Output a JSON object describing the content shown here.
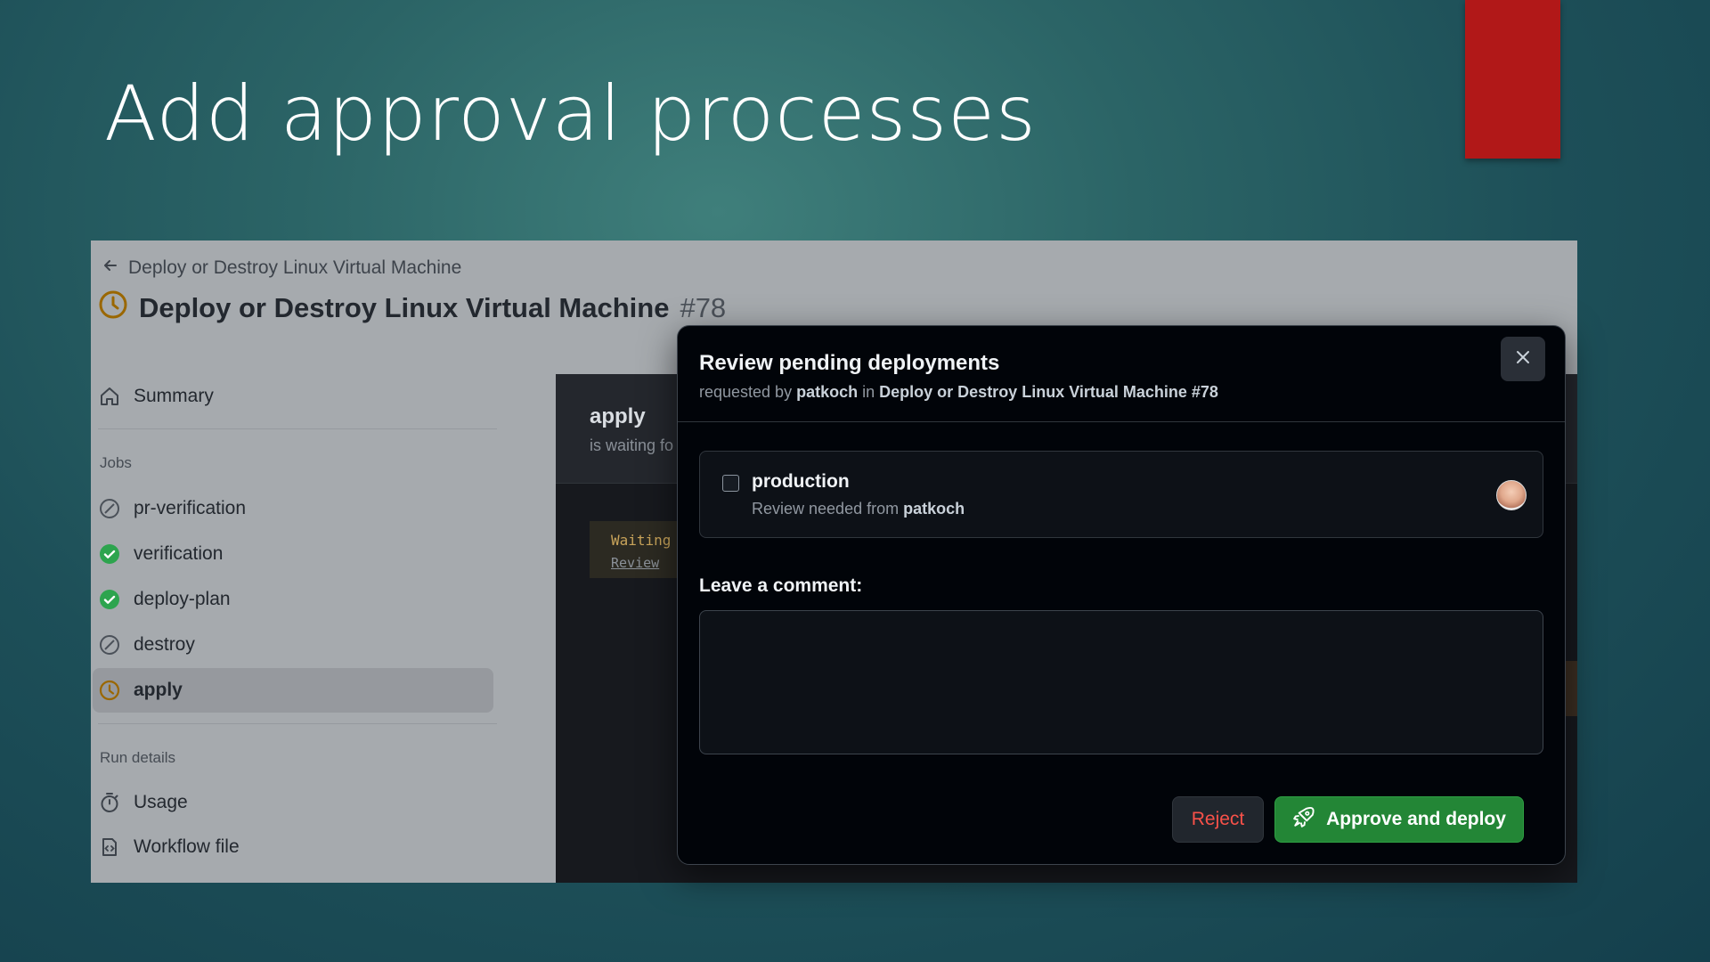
{
  "slide": {
    "title": "Add approval processes"
  },
  "header": {
    "back_label": "Deploy or Destroy Linux Virtual Machine",
    "run_title": "Deploy or Destroy Linux Virtual Machine",
    "run_number": "#78"
  },
  "sidebar": {
    "summary": "Summary",
    "jobs_heading": "Jobs",
    "jobs": [
      {
        "label": "pr-verification",
        "status": "skipped"
      },
      {
        "label": "verification",
        "status": "success"
      },
      {
        "label": "deploy-plan",
        "status": "success"
      },
      {
        "label": "destroy",
        "status": "skipped"
      },
      {
        "label": "apply",
        "status": "waiting",
        "active": true
      }
    ],
    "run_details_heading": "Run details",
    "usage": "Usage",
    "workflow_file": "Workflow file"
  },
  "job_panel": {
    "name": "apply",
    "subtitle": "is waiting fo",
    "log_line1": "Waiting",
    "log_line2": "Review"
  },
  "modal": {
    "title": "Review pending deployments",
    "sub_prefix": "requested by",
    "requester": "patkoch",
    "sub_in": "in",
    "sub_workflow": "Deploy or Destroy Linux Virtual Machine #78",
    "environment": {
      "name": "production",
      "note_prefix": "Review needed from",
      "reviewer": "patkoch"
    },
    "comment_label": "Leave a comment:",
    "comment_value": "",
    "reject_label": "Reject",
    "approve_label": "Approve and deploy"
  },
  "colors": {
    "accent_red": "#b11818",
    "success": "#2da44e",
    "waiting": "#9a6700",
    "approve": "#238636",
    "reject_text": "#f85149"
  }
}
